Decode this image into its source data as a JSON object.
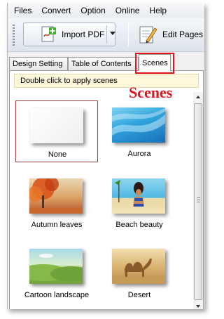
{
  "menubar": {
    "items": [
      "Files",
      "Convert",
      "Option",
      "Online",
      "Help"
    ]
  },
  "toolbar": {
    "import_label": "Import PDF",
    "edit_label": "Edit Pages"
  },
  "tabs": [
    {
      "label": "Design Setting"
    },
    {
      "label": "Table of Contents"
    },
    {
      "label": "Scenes"
    }
  ],
  "panel": {
    "hint": "Double click to apply scenes",
    "annotation": "Scenes"
  },
  "scenes": [
    {
      "label": "None",
      "selected": true
    },
    {
      "label": "Aurora"
    },
    {
      "label": "Autumn leaves"
    },
    {
      "label": "Beach beauty"
    },
    {
      "label": "Cartoon landscape"
    },
    {
      "label": "Desert"
    }
  ],
  "colors": {
    "annotation": "#e0141e",
    "hint_bg": "#fdf7dc"
  }
}
